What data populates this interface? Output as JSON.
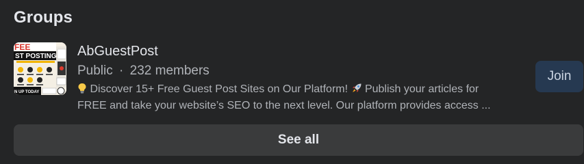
{
  "section": {
    "title": "Groups"
  },
  "group": {
    "name": "AbGuestPost",
    "privacy": "Public",
    "separator": "·",
    "members": "232 members",
    "description_line1": "Discover 15+ Free Guest Post Sites on Our Platform!",
    "description_line1_tail": "Publish your articles for",
    "description_line2": "FREE and take your website’s SEO to the next level. Our platform provides access ...",
    "thumbnail_text": {
      "line1": "FEE",
      "line2": "ST POSTING!",
      "footer": "N UP TODAY"
    },
    "icons": {
      "bulb": "lightbulb-icon",
      "rocket": "rocket-icon"
    }
  },
  "actions": {
    "join_label": "Join",
    "see_all_label": "See all"
  },
  "colors": {
    "background": "#242526",
    "join_bg": "#263951",
    "see_all_bg": "#3a3b3c"
  }
}
